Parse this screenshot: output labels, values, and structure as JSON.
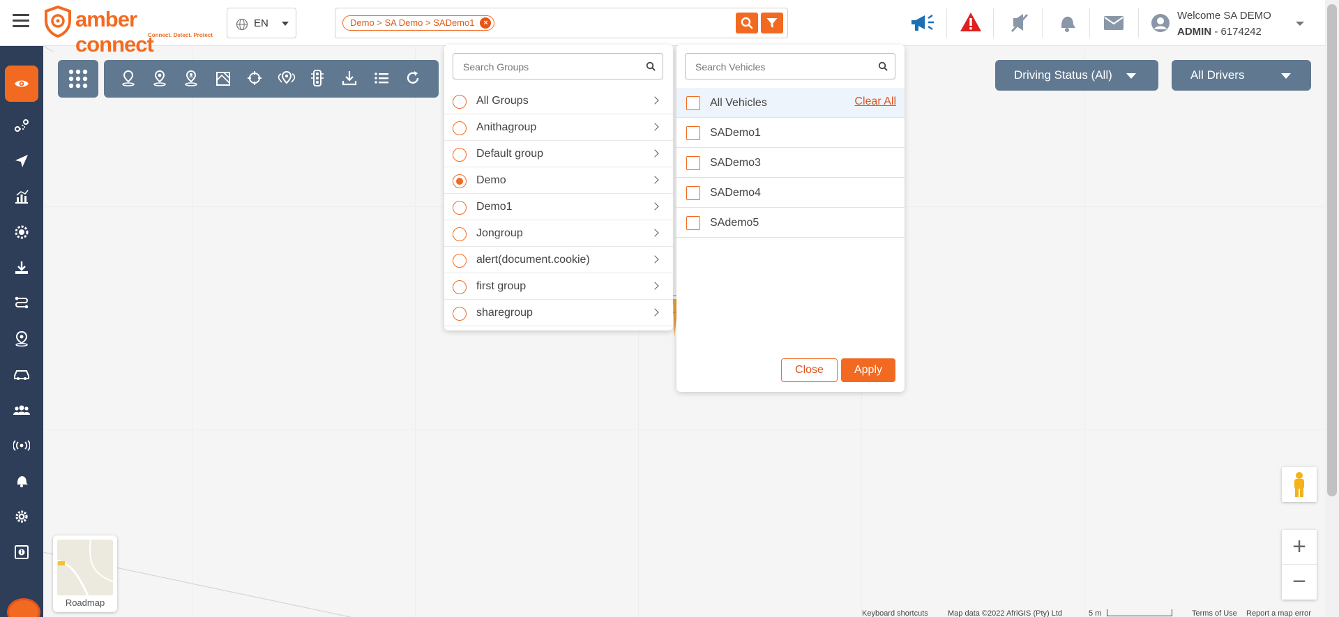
{
  "header": {
    "logo_text": "amber connect",
    "logo_tagline": "Connect. Detect. Protect",
    "language": "EN",
    "breadcrumb_chip": "Demo > SA Demo > SADemo1",
    "welcome": "Welcome SA DEMO",
    "role": "ADMIN",
    "account_id": " - 6174242"
  },
  "sidebar": {
    "items": [
      "live-view",
      "route-playback",
      "navigate",
      "reports",
      "geofence",
      "download",
      "trips",
      "location",
      "vehicles",
      "users",
      "devices",
      "alerts",
      "settings",
      "info"
    ]
  },
  "toolbar": {
    "tools": [
      "add-location",
      "pin-location",
      "user-location",
      "map-area",
      "crosshair",
      "multi-pin",
      "traffic",
      "download",
      "list",
      "refresh"
    ]
  },
  "filters": {
    "driving_status": "Driving Status (All)",
    "drivers": "All Drivers"
  },
  "groups_panel": {
    "search_placeholder": "Search Groups",
    "groups": [
      {
        "label": "All Groups",
        "selected": false
      },
      {
        "label": "Anithagroup",
        "selected": false
      },
      {
        "label": "Default group",
        "selected": false
      },
      {
        "label": "Demo",
        "selected": true
      },
      {
        "label": "Demo1",
        "selected": false
      },
      {
        "label": "Jongroup",
        "selected": false
      },
      {
        "label": "alert(document.cookie)",
        "selected": false
      },
      {
        "label": "first group",
        "selected": false
      },
      {
        "label": "sharegroup",
        "selected": false
      }
    ]
  },
  "vehicles_panel": {
    "search_placeholder": "Search Vehicles",
    "all_label": "All Vehicles",
    "clear_all": "Clear All",
    "vehicles": [
      "SADemo1",
      "SADemo3",
      "SADemo4",
      "SAdemo5"
    ],
    "close": "Close",
    "apply": "Apply"
  },
  "map": {
    "roadmap_label": "Roadmap",
    "zoom_in": "+",
    "zoom_out": "−",
    "attribution": {
      "shortcuts": "Keyboard shortcuts",
      "map_data": "Map data ©2022 AfriGIS (Pty) Ltd",
      "scale": "5 m",
      "terms": "Terms of Use",
      "report": "Report a map error"
    }
  },
  "colors": {
    "accent": "#f26a21",
    "sidebar": "#2f3e58",
    "toolbar": "#607890",
    "alert_red": "#e02020",
    "megaphone_blue": "#1a6fb5"
  }
}
